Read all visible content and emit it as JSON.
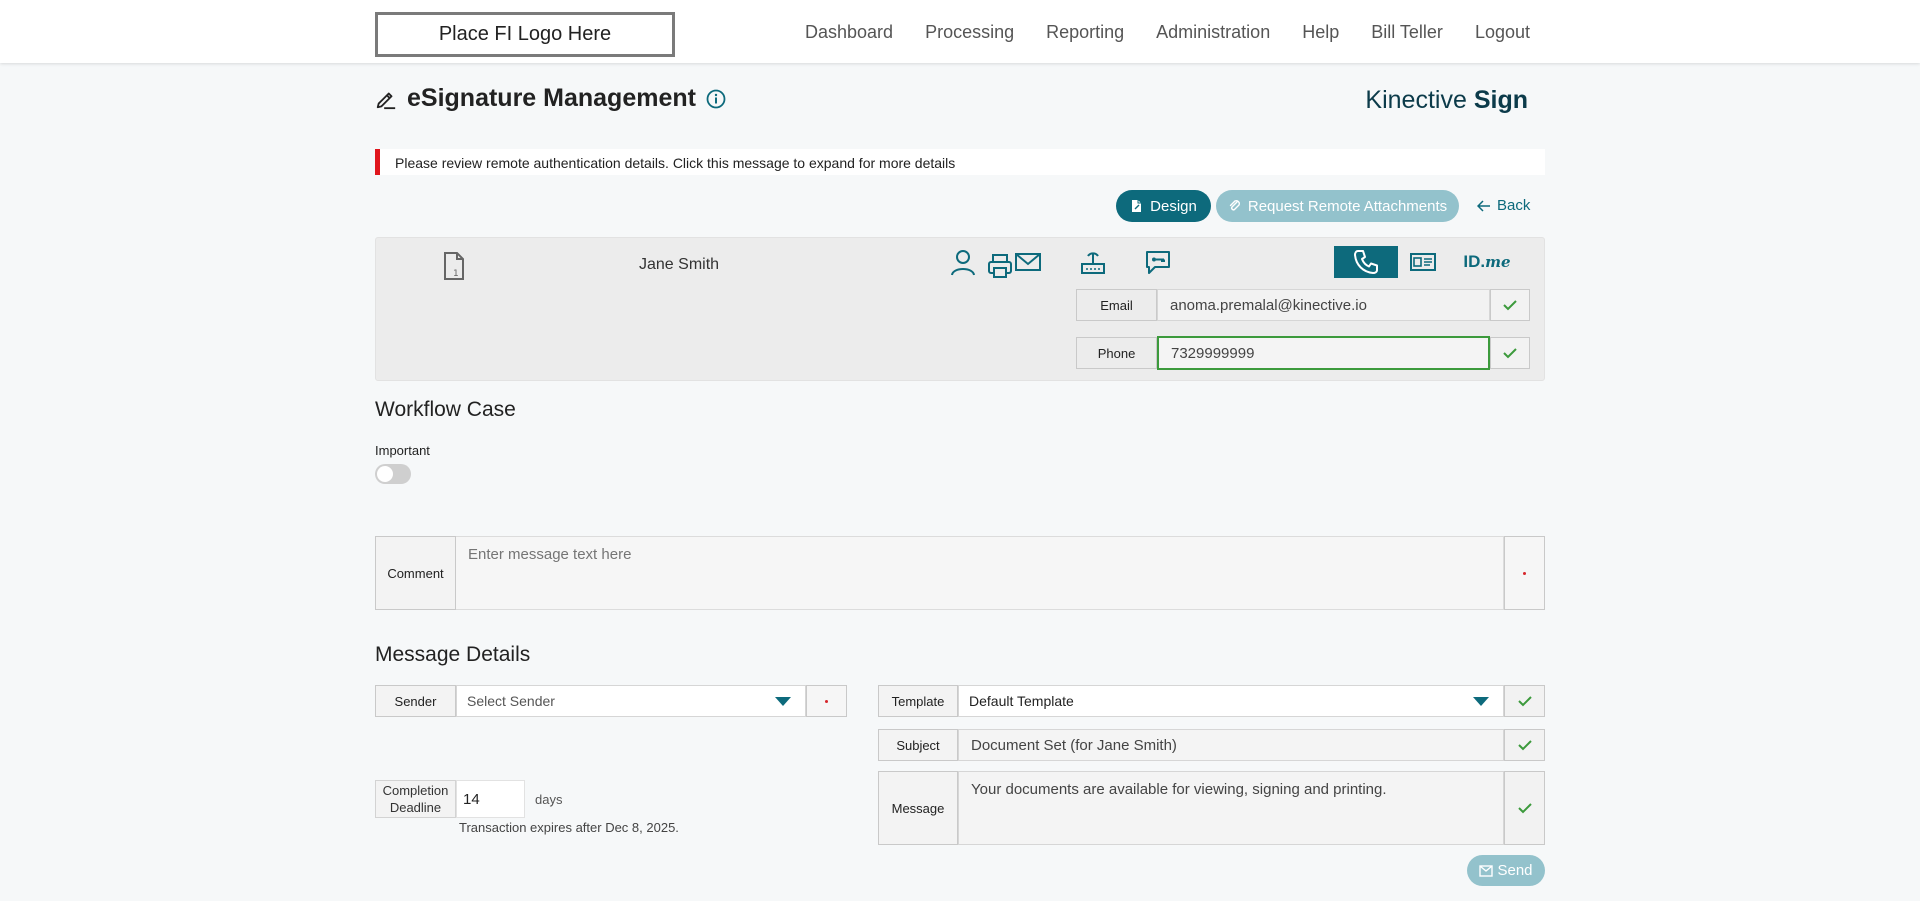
{
  "header": {
    "logo_text": "Place FI Logo Here",
    "nav": [
      "Dashboard",
      "Processing",
      "Reporting",
      "Administration",
      "Help",
      "Bill Teller",
      "Logout"
    ]
  },
  "page": {
    "title": "eSignature Management",
    "brand_light": "Kinective",
    "brand_bold": "Sign"
  },
  "alert": {
    "text": "Please review remote authentication details. Click this message to expand for more details",
    "color": "#e0161d"
  },
  "actions": {
    "design_label": "Design",
    "remote_label": "Request Remote Attachments",
    "back_label": "Back"
  },
  "signer": {
    "name": "Jane Smith",
    "auth_methods": [
      "person-icon",
      "envelope-icon",
      "router-icon",
      "chat-key-icon",
      "phone-icon",
      "id-card-icon",
      "idme-logo"
    ],
    "active_method": "phone-icon",
    "idme_text": "ID.",
    "idme_me": "me",
    "email_label": "Email",
    "email_value": "anoma.premalal@kinective.io",
    "phone_label": "Phone",
    "phone_value": "7329999999"
  },
  "workflow": {
    "title": "Workflow Case",
    "important_label": "Important",
    "important_on": false,
    "comment_label": "Comment",
    "comment_placeholder": "Enter message text here"
  },
  "message_details": {
    "title": "Message Details",
    "sender_label": "Sender",
    "sender_placeholder": "Select Sender",
    "template_label": "Template",
    "template_value": "Default Template",
    "subject_label": "Subject",
    "subject_value": "Document Set (for Jane Smith)",
    "message_label": "Message",
    "message_value": "Your documents are available for viewing, signing and printing.",
    "deadline_label_1": "Completion",
    "deadline_label_2": "Deadline",
    "deadline_value": "14",
    "deadline_unit": "days",
    "expires_text": "Transaction expires after Dec 8, 2025.",
    "send_label": "Send"
  },
  "colors": {
    "accent": "#0d6a7c",
    "accent_disabled": "#93c2cc",
    "check": "#3c9a3c"
  }
}
